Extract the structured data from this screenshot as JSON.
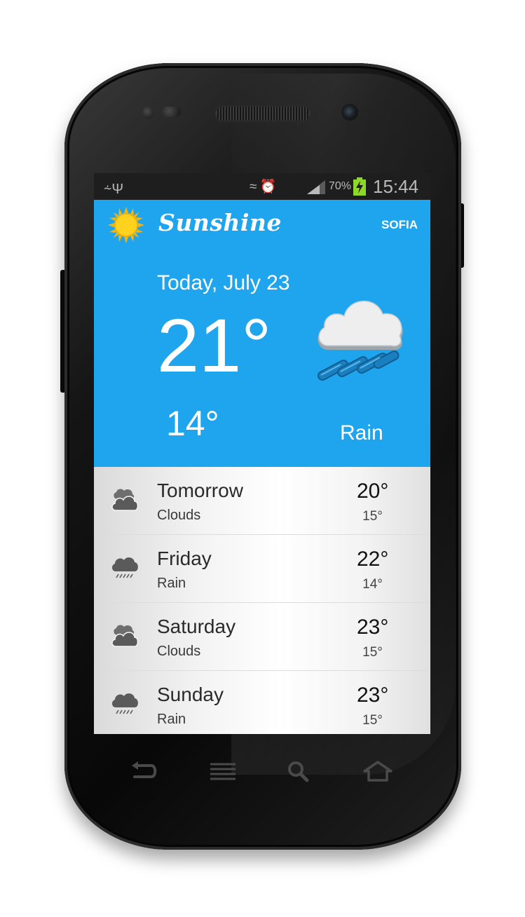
{
  "status_bar": {
    "usb_icon": "usb-icon",
    "icons": [
      "vibrate-icon",
      "alarm-icon"
    ],
    "signal_icon": "signal-icon",
    "battery_percent": "70%",
    "battery_icon": "battery-charging-icon",
    "time": "15:44"
  },
  "action_bar": {
    "logo_icon": "sun-icon",
    "title": "Sunshine",
    "city": "SOFIA"
  },
  "today": {
    "date": "Today, July 23",
    "high": "21°",
    "low": "14°",
    "icon": "rain-cloud-icon",
    "description": "Rain"
  },
  "forecast": [
    {
      "day": "Tomorrow",
      "desc": "Clouds",
      "high": "20°",
      "low": "15°",
      "icon": "clouds-icon"
    },
    {
      "day": "Friday",
      "desc": "Rain",
      "high": "22°",
      "low": "14°",
      "icon": "rain-icon"
    },
    {
      "day": "Saturday",
      "desc": "Clouds",
      "high": "23°",
      "low": "15°",
      "icon": "clouds-icon"
    },
    {
      "day": "Sunday",
      "desc": "Rain",
      "high": "23°",
      "low": "15°",
      "icon": "rain-icon"
    }
  ],
  "nav_keys": [
    "back-icon",
    "menu-icon",
    "search-icon",
    "home-icon"
  ],
  "colors": {
    "accent": "#1fa4ee",
    "status_bar": "#1e1e1e",
    "sun": "#ffd21e",
    "battery_charge": "#8fd82a"
  }
}
